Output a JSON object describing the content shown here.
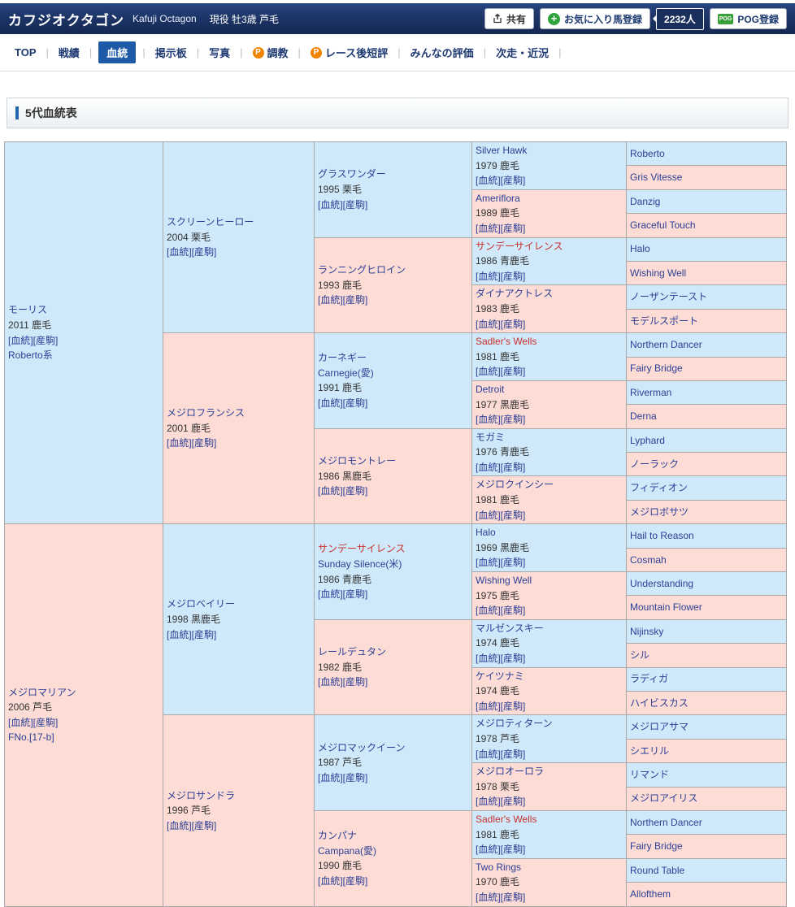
{
  "header": {
    "horse_name": "カフジオクタゴン",
    "horse_name_en": "Kafuji Octagon",
    "status": "現役 牡3歳 芦毛",
    "share_label": "共有",
    "favorite_label": "お気に入り馬登録",
    "favorite_count": "2232人",
    "pog_icon_label": "POG",
    "pog_label": "POG登録"
  },
  "nav": {
    "items": [
      {
        "key": "top",
        "label": "TOP"
      },
      {
        "key": "results",
        "label": "戦績"
      },
      {
        "key": "blood",
        "label": "血統",
        "active": true
      },
      {
        "key": "board",
        "label": "掲示板"
      },
      {
        "key": "photo",
        "label": "写真"
      },
      {
        "key": "training",
        "label": "調教",
        "p": true
      },
      {
        "key": "race-review",
        "label": "レース後短評",
        "p": true
      },
      {
        "key": "rating",
        "label": "みんなの評価"
      },
      {
        "key": "next-race",
        "label": "次走・近況"
      }
    ]
  },
  "section": {
    "title": "5代血統表"
  },
  "colors": {
    "accent_blue": "#1e5aa8",
    "male_cell_bg": "#cfe9fa",
    "female_cell_bg": "#fddcd5",
    "highlight_red": "#c9302c",
    "p_icon_orange": "#f08300",
    "favorite_green": "#2fa43c",
    "header_navy": "#1b3263"
  },
  "pedigree": {
    "blood_label": "[血統]",
    "offspring_label": "[産駒]",
    "g1": [
      {
        "name": "モーリス",
        "year_coat": "2011 鹿毛",
        "extra": "Roberto系"
      },
      {
        "name": "メジロマリアン",
        "year_coat": "2006 芦毛",
        "extra": "FNo.[17-b]"
      }
    ],
    "g2": [
      {
        "name": "スクリーンヒーロー",
        "year_coat": "2004 栗毛"
      },
      {
        "name": "メジロフランシス",
        "year_coat": "2001 鹿毛"
      },
      {
        "name": "メジロベイリー",
        "year_coat": "1998 黒鹿毛"
      },
      {
        "name": "メジロサンドラ",
        "year_coat": "1996 芦毛"
      }
    ],
    "g3": [
      {
        "name": "グラスワンダー",
        "year_coat": "1995 栗毛"
      },
      {
        "name": "ランニングヒロイン",
        "year_coat": "1993 鹿毛"
      },
      {
        "name": "カーネギー",
        "en": "Carnegie(愛)",
        "year_coat": "1991 鹿毛"
      },
      {
        "name": "メジロモントレー",
        "year_coat": "1986 黒鹿毛"
      },
      {
        "name": "サンデーサイレンス",
        "red": true,
        "en": "Sunday Silence(米)",
        "year_coat": "1986 青鹿毛"
      },
      {
        "name": "レールデュタン",
        "year_coat": "1982 鹿毛"
      },
      {
        "name": "メジロマックイーン",
        "year_coat": "1987 芦毛"
      },
      {
        "name": "カンパナ",
        "en": "Campana(愛)",
        "year_coat": "1990 鹿毛"
      }
    ],
    "g4": [
      {
        "name": "Silver Hawk",
        "year_coat": "1979 鹿毛"
      },
      {
        "name": "Ameriflora",
        "year_coat": "1989 鹿毛"
      },
      {
        "name": "サンデーサイレンス",
        "red": true,
        "year_coat": "1986 青鹿毛"
      },
      {
        "name": "ダイナアクトレス",
        "year_coat": "1983 鹿毛"
      },
      {
        "name": "Sadler's Wells",
        "red": true,
        "year_coat": "1981 鹿毛"
      },
      {
        "name": "Detroit",
        "year_coat": "1977 黒鹿毛"
      },
      {
        "name": "モガミ",
        "year_coat": "1976 青鹿毛"
      },
      {
        "name": "メジロクインシー",
        "year_coat": "1981 鹿毛"
      },
      {
        "name": "Halo",
        "year_coat": "1969 黒鹿毛"
      },
      {
        "name": "Wishing Well",
        "year_coat": "1975 鹿毛"
      },
      {
        "name": "マルゼンスキー",
        "year_coat": "1974 鹿毛"
      },
      {
        "name": "ケイツナミ",
        "year_coat": "1974 鹿毛"
      },
      {
        "name": "メジロティターン",
        "year_coat": "1978 芦毛"
      },
      {
        "name": "メジロオーロラ",
        "year_coat": "1978 栗毛"
      },
      {
        "name": "Sadler's Wells",
        "red": true,
        "year_coat": "1981 鹿毛"
      },
      {
        "name": "Two Rings",
        "year_coat": "1970 鹿毛"
      }
    ],
    "g5": [
      "Roberto",
      "Gris Vitesse",
      "Danzig",
      "Graceful Touch",
      "Halo",
      "Wishing Well",
      "ノーザンテースト",
      "モデルスポート",
      "Northern Dancer",
      "Fairy Bridge",
      "Riverman",
      "Derna",
      "Lyphard",
      "ノーラック",
      "フィディオン",
      "メジロボサツ",
      "Hail to Reason",
      "Cosmah",
      "Understanding",
      "Mountain Flower",
      "Nijinsky",
      "シル",
      "ラディガ",
      "ハイビスカス",
      "メジロアサマ",
      "シエリル",
      "リマンド",
      "メジロアイリス",
      "Northern Dancer",
      "Fairy Bridge",
      "Round Table",
      "Allofthem"
    ]
  }
}
